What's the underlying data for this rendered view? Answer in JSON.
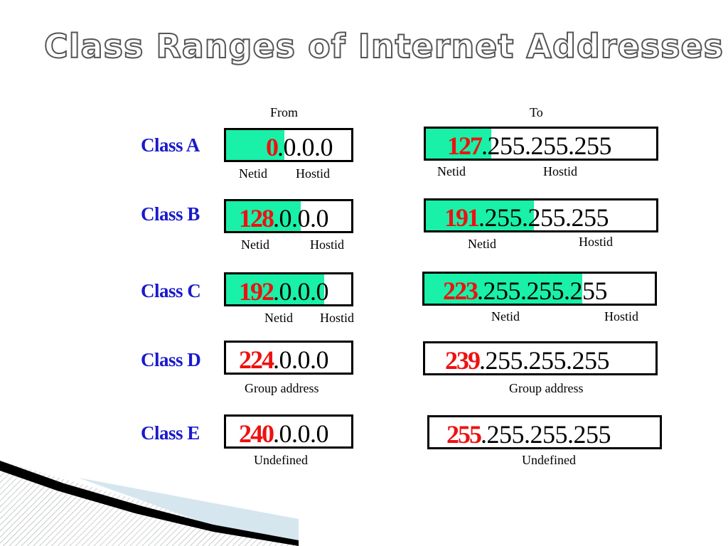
{
  "title": "Class Ranges of Internet Addresses",
  "columns": {
    "from": "From",
    "to": "To"
  },
  "colors": {
    "netid_fill": "#19f0a8",
    "first_octet": "#ee1111",
    "class_label": "#1a1acc"
  },
  "classes": [
    {
      "label": "Class A",
      "from": {
        "first": "0",
        "rest": ".0.0.0",
        "labels": [
          "Netid",
          "Hostid"
        ]
      },
      "to": {
        "first": "127",
        "rest": ".255.255.255",
        "labels": [
          "Netid",
          "Hostid"
        ]
      }
    },
    {
      "label": "Class B",
      "from": {
        "first": "128",
        "rest": ".0.0.0",
        "labels": [
          "Netid",
          "Hostid"
        ]
      },
      "to": {
        "first": "191",
        "rest": ".255.255.255",
        "labels": [
          "Netid",
          "Hostid"
        ]
      }
    },
    {
      "label": "Class C",
      "from": {
        "first": "192",
        "rest": ".0.0.0",
        "labels": [
          "Netid",
          "Hostid"
        ]
      },
      "to": {
        "first": "223",
        "rest": ".255.255.255",
        "labels": [
          "Netid",
          "Hostid"
        ]
      }
    },
    {
      "label": "Class D",
      "from": {
        "first": "224",
        "rest": ".0.0.0",
        "labels": [
          "Group address"
        ]
      },
      "to": {
        "first": "239",
        "rest": ".255.255.255",
        "labels": [
          "Group address"
        ]
      }
    },
    {
      "label": "Class E",
      "from": {
        "first": "240",
        "rest": ".0.0.0",
        "labels": [
          "Undefined"
        ]
      },
      "to": {
        "first": "255",
        "rest": ".255.255.255",
        "labels": [
          "Undefined"
        ]
      }
    }
  ]
}
